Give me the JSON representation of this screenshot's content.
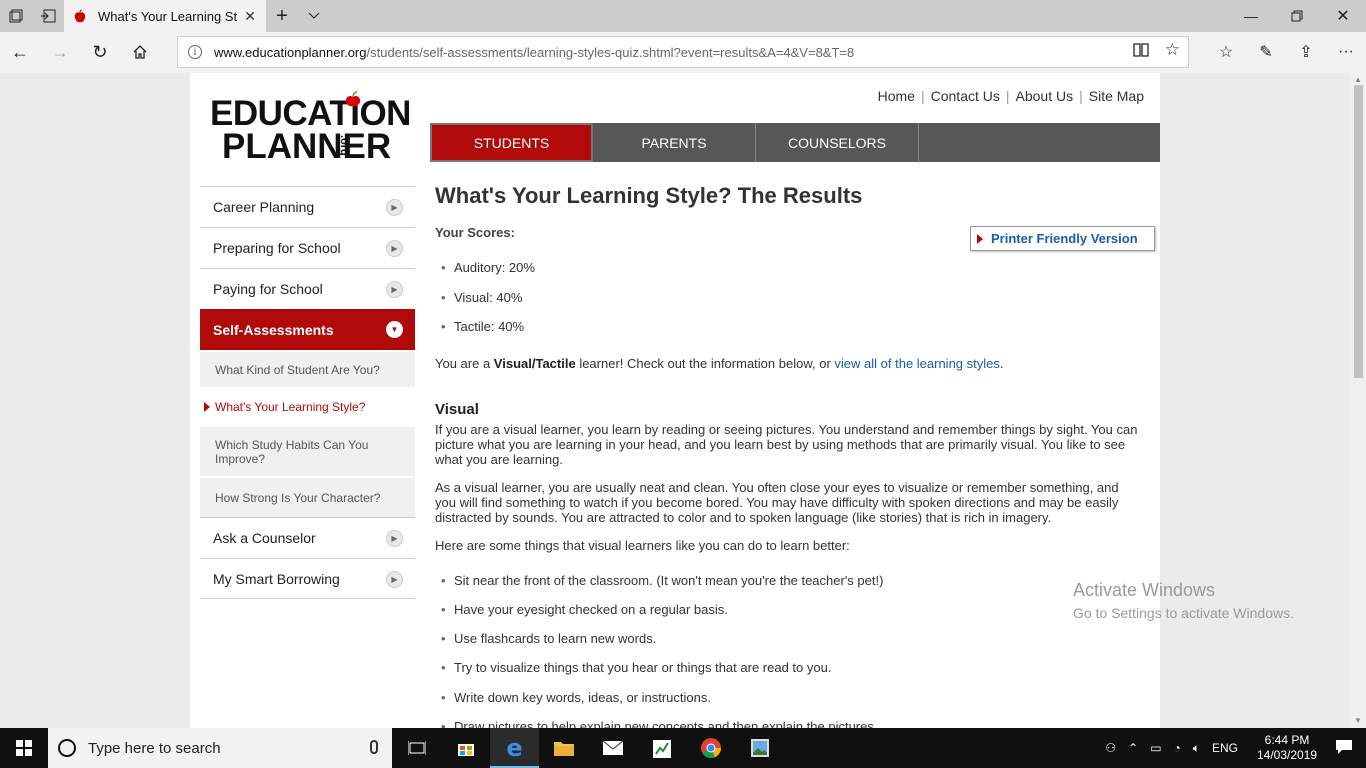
{
  "browser": {
    "tab_title": "What's Your Learning St",
    "url_host": "www.educationplanner.org",
    "url_path": "/students/self-assessments/learning-styles-quiz.shtml?event=results&A=4&V=8&T=8"
  },
  "toplinks": [
    "Home",
    "Contact Us",
    "About Us",
    "Site Map"
  ],
  "logo": {
    "line1": "EDUCATION",
    "line2": "PLANNER",
    "org": ".org"
  },
  "mainnav": [
    "STUDENTS",
    "PARENTS",
    "COUNSELORS"
  ],
  "sidebar": {
    "items": [
      "Career Planning",
      "Preparing for School",
      "Paying for School"
    ],
    "active": "Self-Assessments",
    "subitems": [
      "What Kind of Student Are You?",
      "What's Your Learning Style?",
      "Which Study Habits Can You Improve?",
      "How Strong Is Your Character?"
    ],
    "items_after": [
      "Ask a Counselor",
      "My Smart Borrowing"
    ]
  },
  "content": {
    "title": "What's Your Learning Style? The Results",
    "scores_label": "Your Scores:",
    "printer_label": "Printer Friendly Version",
    "scores": [
      "Auditory: 20%",
      "Visual: 40%",
      "Tactile: 40%"
    ],
    "intro_pre": "You are a ",
    "intro_bold": "Visual/Tactile",
    "intro_mid": " learner! Check out the information below, or ",
    "intro_link": "view all of the learning styles",
    "intro_post": ".",
    "visual_heading": "Visual",
    "para1": "If you are a visual learner, you learn by reading or seeing pictures. You understand and remember things by sight. You can picture what you are learning in your head, and you learn best by using methods that are primarily visual. You like to see what you are learning.",
    "para2": "As a visual learner, you are usually neat and clean. You often close your eyes to visualize or remember something, and you will find something to watch if you become bored. You may have difficulty with spoken directions and may be easily distracted by sounds. You are attracted to color and to spoken language (like stories) that is rich in imagery.",
    "para3": "Here are some things that visual learners like you can do to learn better:",
    "tips": [
      "Sit near the front of the classroom. (It won't mean you're the teacher's pet!)",
      "Have your eyesight checked on a regular basis.",
      "Use flashcards to learn new words.",
      "Try to visualize things that you hear or things that are read to you.",
      "Write down key words, ideas, or instructions.",
      "Draw pictures to help explain new concepts and then explain the pictures."
    ]
  },
  "watermark": {
    "line1": "Activate Windows",
    "line2": "Go to Settings to activate Windows."
  },
  "taskbar": {
    "search_placeholder": "Type here to search",
    "lang": "ENG",
    "time": "6:44 PM",
    "date": "14/03/2019"
  }
}
